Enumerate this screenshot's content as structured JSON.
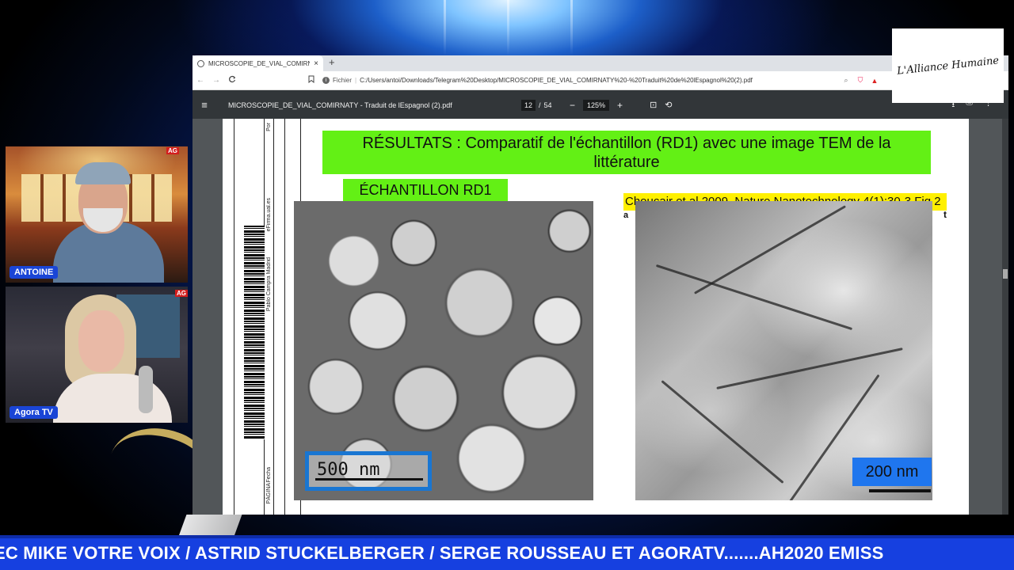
{
  "browser": {
    "tab_title": "MICROSCOPIE_DE_VIAL_COMIRNATY",
    "tab_close": "×",
    "new_tab": "+",
    "nav_back": "←",
    "nav_forward": "→",
    "nav_reload": "C",
    "url_scheme_label": "Fichier",
    "url_separator": "|",
    "url_path": "C:/Users/antoi/Downloads/Telegram%20Desktop/MICROSCOPIE_DE_VIAL_COMIRNATY%20-%20Traduit%20de%20lEspagnol%20(2).pdf"
  },
  "pdf_toolbar": {
    "title": "MICROSCOPIE_DE_VIAL_COMIRNATY - Traduit de lEspagnol (2).pdf",
    "current_page": "12",
    "page_separator": "/",
    "total_pages": "54",
    "zoom": "125%",
    "zoom_out": "−",
    "zoom_in": "+"
  },
  "document": {
    "banner_line1": "RÉSULTATS : Comparatif de l'échantillon (RD1) avec une image TEM de la",
    "banner_line2": "littérature",
    "sample_label": "ÉCHANTILLON RD1",
    "reference_label": "Choucair et al 2009. Nature Nanotechnology 4(1):30-3 Fig 2",
    "panel_letter_left": "a",
    "panel_letter_right": "t",
    "left_scale": "500 nm",
    "right_scale": "200 nm",
    "strip_text_1": "Pablo Campra Madrid",
    "strip_text_2": "Fecha",
    "strip_text_3": "PÁGINA",
    "strip_text_4": "eFirma.ual.es",
    "strip_text_5": "Por"
  },
  "logo": {
    "text": "L'Alliance Humaine"
  },
  "cams": {
    "cam1_name": "ANTOINE",
    "cam1_tag": "AG",
    "cam2_name": "Agora TV",
    "cam2_tag": "AG"
  },
  "ticker": {
    "text": "EC MIKE VOTRE VOIX / ASTRID STUCKELBERGER / SERGE ROUSSEAU ET AGORATV.......AH2020 EMISS"
  },
  "colors": {
    "ticker_bg": "#1640e0",
    "banner_green": "#63f015",
    "reference_yellow": "#fff000",
    "scale_blue": "#1f76ee"
  }
}
